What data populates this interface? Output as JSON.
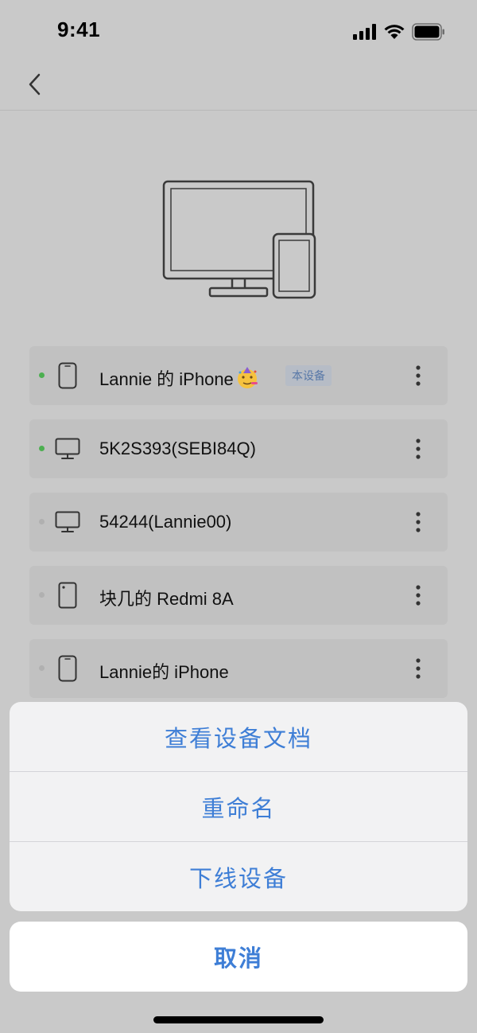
{
  "status_bar": {
    "time": "9:41",
    "icons": [
      "cellular-signal-icon",
      "wifi-icon",
      "battery-icon"
    ]
  },
  "nav": {
    "back_icon": "chevron-left-icon"
  },
  "hero_icon": "monitor-and-phone-icon",
  "devices": [
    {
      "name": "Lannie 的 iPhone",
      "emoji": "party-face-emoji",
      "badge": "本设备",
      "online": true,
      "icon": "phone-icon"
    },
    {
      "name": "5K2S393(SEBI84Q)",
      "online": true,
      "icon": "desktop-icon"
    },
    {
      "name": "54244(Lannie00)",
      "online": false,
      "icon": "desktop-icon"
    },
    {
      "name": "块几的 Redmi 8A",
      "online": false,
      "icon": "android-phone-icon"
    },
    {
      "name": "Lannie的 iPhone",
      "online": false,
      "icon": "phone-icon"
    }
  ],
  "action_sheet": {
    "items": [
      "查看设备文档",
      "重命名",
      "下线设备"
    ],
    "cancel": "取消"
  },
  "colors": {
    "online_dot": "#4caf50",
    "offline_dot": "#b0b0b0",
    "action_text": "#3e7ed6",
    "badge_bg": "#b6bcc6",
    "badge_text": "#5878a8"
  }
}
